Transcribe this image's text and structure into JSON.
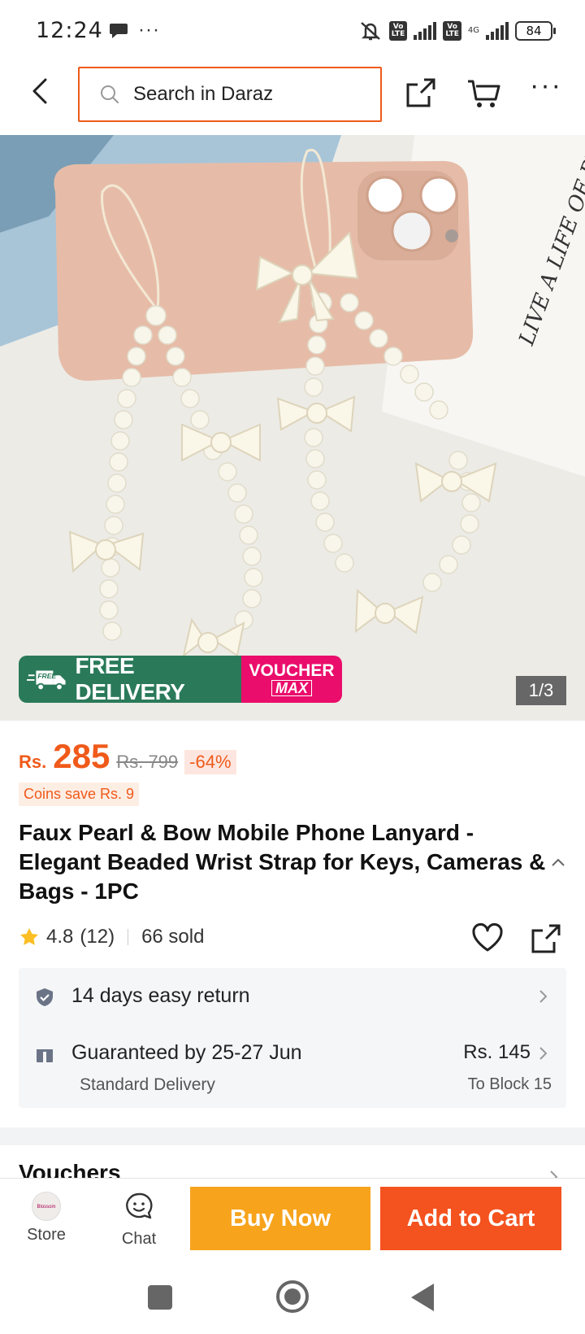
{
  "status_bar": {
    "time": "12:24",
    "network": "4G",
    "battery": "84",
    "volte_label": "Vo LTE"
  },
  "nav": {
    "search_placeholder": "Search in Daraz"
  },
  "gallery": {
    "free_tag": "FREE",
    "free_delivery_label": "FREE DELIVERY",
    "voucher_label": "VOUCHER",
    "max_label": "MAX",
    "counter": "1/3",
    "photo_text": "LIVE A LIFE OF PU"
  },
  "price": {
    "currency": "Rs.",
    "amount": "285",
    "original": "Rs. 799",
    "discount": "-64%",
    "coins": "Coins save Rs. 9"
  },
  "product": {
    "title": "Faux Pearl & Bow Mobile Phone Lanyard - Elegant Beaded Wrist Strap for Keys, Cameras & Bags - 1PC",
    "rating": "4.8",
    "rating_count": "(12)",
    "sold": "66 sold"
  },
  "services": {
    "return_text": "14 days easy return",
    "delivery_text": "Guaranteed by 25-27 Jun",
    "delivery_type": "Standard Delivery",
    "delivery_price": "Rs. 145",
    "delivery_to": "To Block 15"
  },
  "sections": {
    "vouchers": "Vouchers"
  },
  "action_bar": {
    "store_label": "Store",
    "chat_label": "Chat",
    "buy_now": "Buy Now",
    "add_to_cart": "Add to Cart",
    "store_logo_text": "Blossom"
  },
  "colors": {
    "accent": "#f05a1a",
    "buy_now": "#f7a31c",
    "add_to_cart": "#f4521e",
    "free_delivery_bg": "#2a7a5a",
    "voucher_bg": "#ea0d6b"
  }
}
